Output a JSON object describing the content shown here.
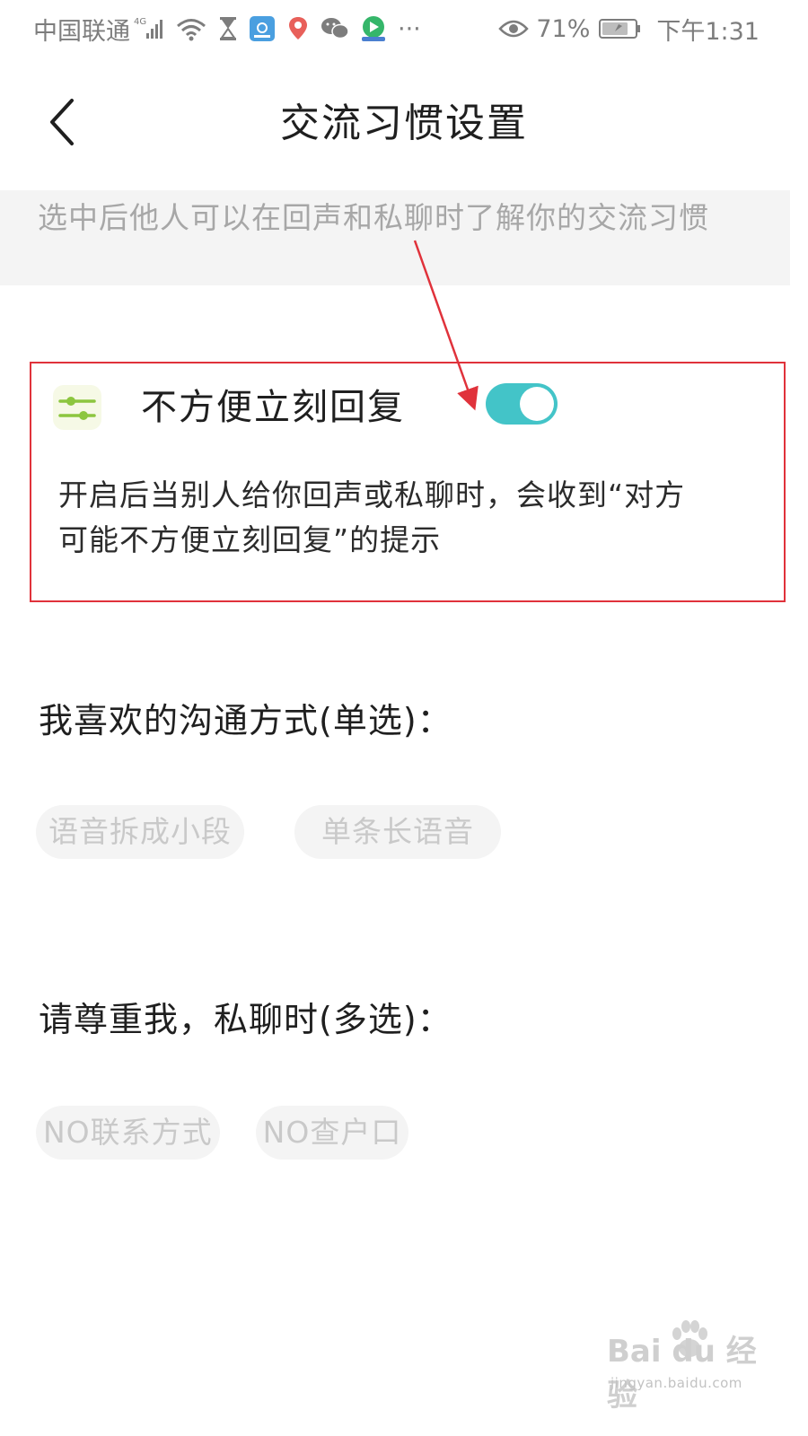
{
  "status_bar": {
    "carrier": "中国联通",
    "network": "4G",
    "battery_percent": "71%",
    "time": "下午1:31",
    "more": "···",
    "icons": [
      "signal-icon",
      "wifi-icon",
      "hourglass-icon",
      "app-notification-icon",
      "location-app-icon",
      "wechat-icon",
      "video-app-icon",
      "eye-icon",
      "battery-icon"
    ]
  },
  "header": {
    "back_icon": "chevron-left-icon",
    "title": "交流习惯设置"
  },
  "banner": {
    "text": "选中后他人可以在回声和私聊时了解你的交流习惯"
  },
  "setting": {
    "icon": "sliders-icon",
    "title": "不方便立刻回复",
    "toggle_on": true,
    "accent_color": "#43c4c8",
    "highlight_color": "#e0323b",
    "description": "开启后当别人给你回声或私聊时，会收到“对方可能不方便立刻回复”的提示"
  },
  "communication_section": {
    "title": "我喜欢的沟通方式(单选)：",
    "options": [
      "语音拆成小段",
      "单条长语音"
    ]
  },
  "private_chat_section": {
    "title": "请尊重我，私聊时(多选)：",
    "options": [
      "NO联系方式",
      "NO查户口"
    ]
  },
  "watermark": {
    "brand": "Bai du 经验",
    "url": "jingyan.baidu.com"
  }
}
